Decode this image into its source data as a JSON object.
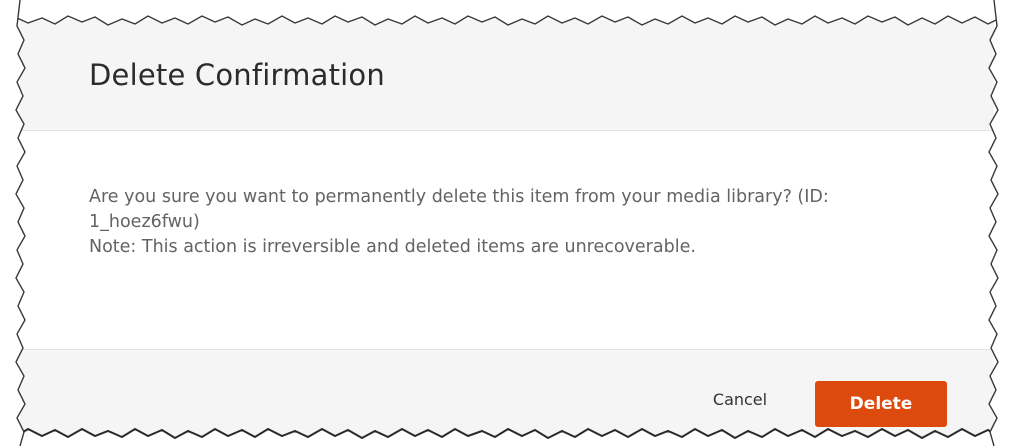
{
  "dialog": {
    "title": "Delete Confirmation",
    "message_line1": "Are you sure you want to permanently delete this item from your media library? (ID: 1_hoez6fwu)",
    "message_line2": "Note: This action is irreversible and deleted items are unrecoverable.",
    "cancel_label": "Cancel",
    "delete_label": "Delete"
  },
  "colors": {
    "primary_action": "#dc4a0e",
    "header_footer_bg": "#f5f5f5",
    "title_text": "#2b2b2b",
    "body_text": "#636363"
  }
}
